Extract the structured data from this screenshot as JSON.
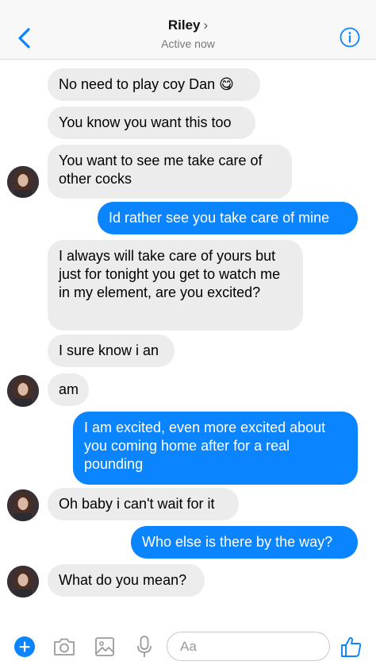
{
  "header": {
    "contact_name": "Riley",
    "chevron": "›",
    "status": "Active now",
    "back_icon": "chevron-left-icon",
    "info_icon": "info-icon"
  },
  "messages": [
    {
      "id": 0,
      "side": "in",
      "text": "No need to play coy Dan 😋"
    },
    {
      "id": 1,
      "side": "in",
      "text": "You know you want this too"
    },
    {
      "id": 2,
      "side": "in",
      "text": "You want to see me take care of other cocks"
    },
    {
      "id": 3,
      "side": "out",
      "text": "Id rather see you take care of mine"
    },
    {
      "id": 4,
      "side": "in",
      "text": "I always will take care of yours but just for tonight you get to watch me in my element, are you excited?"
    },
    {
      "id": 5,
      "side": "in",
      "text": "I sure know i an"
    },
    {
      "id": 6,
      "side": "in",
      "text": "am"
    },
    {
      "id": 7,
      "side": "out",
      "text": "I am excited, even more excited about you coming home after for a real pounding"
    },
    {
      "id": 8,
      "side": "in",
      "text": "Oh baby i can't wait for it"
    },
    {
      "id": 9,
      "side": "out",
      "text": "Who else is there by the way?"
    },
    {
      "id": 10,
      "side": "in",
      "text": "What do you mean?"
    }
  ],
  "composer": {
    "placeholder": "Aa",
    "icons": [
      "plus-icon",
      "camera-icon",
      "image-icon",
      "microphone-icon",
      "thumbs-up-icon"
    ]
  },
  "colors": {
    "accent": "#0a84ff",
    "incoming_bubble": "#ececec",
    "header_bg": "#f8f8f8"
  }
}
